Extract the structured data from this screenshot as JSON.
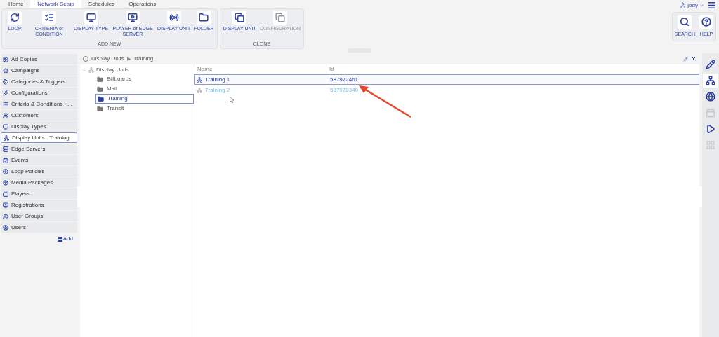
{
  "tabs": [
    {
      "label": "Home",
      "selected": false
    },
    {
      "label": "Network Setup",
      "selected": true
    },
    {
      "label": "Schedules",
      "selected": false
    },
    {
      "label": "Operations",
      "selected": false
    }
  ],
  "user": {
    "name": "jody"
  },
  "ribbon": [
    {
      "title": "ADD NEW",
      "items": [
        {
          "label": "LOOP",
          "disabled": false
        },
        {
          "label": "CRITERIA or CONDITION",
          "disabled": false
        },
        {
          "label": "DISPLAY TYPE",
          "disabled": false
        },
        {
          "label": "PLAYER or EDGE SERVER",
          "disabled": false
        },
        {
          "label": "DISPLAY UNIT",
          "disabled": false
        },
        {
          "label": "FOLDER",
          "disabled": false
        }
      ]
    },
    {
      "title": "CLONE",
      "items": [
        {
          "label": "DISPLAY UNIT",
          "disabled": false
        },
        {
          "label": "CONFIGURATION",
          "disabled": true
        }
      ]
    }
  ],
  "help": [
    {
      "label": "SEARCH"
    },
    {
      "label": "HELP"
    }
  ],
  "sidebar": {
    "items": [
      {
        "label": "Ad Copies",
        "selected": false
      },
      {
        "label": "Campaigns",
        "selected": false
      },
      {
        "label": "Categories & Triggers",
        "selected": false
      },
      {
        "label": "Configurations",
        "selected": false
      },
      {
        "label": "Criteria & Conditions : ...",
        "selected": false
      },
      {
        "label": "Customers",
        "selected": false
      },
      {
        "label": "Display Types",
        "selected": false
      },
      {
        "label": "Display Units : Training",
        "selected": true
      },
      {
        "label": "Edge Servers",
        "selected": false
      },
      {
        "label": "Events",
        "selected": false
      },
      {
        "label": "Loop Policies",
        "selected": false
      },
      {
        "label": "Media Packages",
        "selected": false
      },
      {
        "label": "Players",
        "selected": false
      },
      {
        "label": "Registrations",
        "selected": false
      },
      {
        "label": "User Groups",
        "selected": false
      },
      {
        "label": "Users",
        "selected": false
      }
    ],
    "add_button": "Add"
  },
  "breadcrumb": [
    "Display Units",
    "Training"
  ],
  "breadcrumb_separator": "▶",
  "tree": {
    "label": "Display Units",
    "expanded": true,
    "children": [
      {
        "label": "Billboards",
        "selected": false
      },
      {
        "label": "Mall",
        "selected": false
      },
      {
        "label": "Training",
        "selected": true
      },
      {
        "label": "Transit",
        "selected": false
      }
    ]
  },
  "table": {
    "columns": [
      "Name",
      "Id"
    ],
    "rows": [
      {
        "name": "Training 1",
        "id": "587972461",
        "selected": true,
        "hovered": false
      },
      {
        "name": "Training 2",
        "id": "587978340",
        "selected": false,
        "hovered": true
      }
    ]
  },
  "right_rail": [
    {
      "selected": false,
      "disabled": false
    },
    {
      "selected": true,
      "disabled": false
    },
    {
      "selected": false,
      "disabled": false
    },
    {
      "selected": false,
      "disabled": true
    },
    {
      "selected": false,
      "disabled": false
    },
    {
      "selected": false,
      "disabled": true
    }
  ]
}
